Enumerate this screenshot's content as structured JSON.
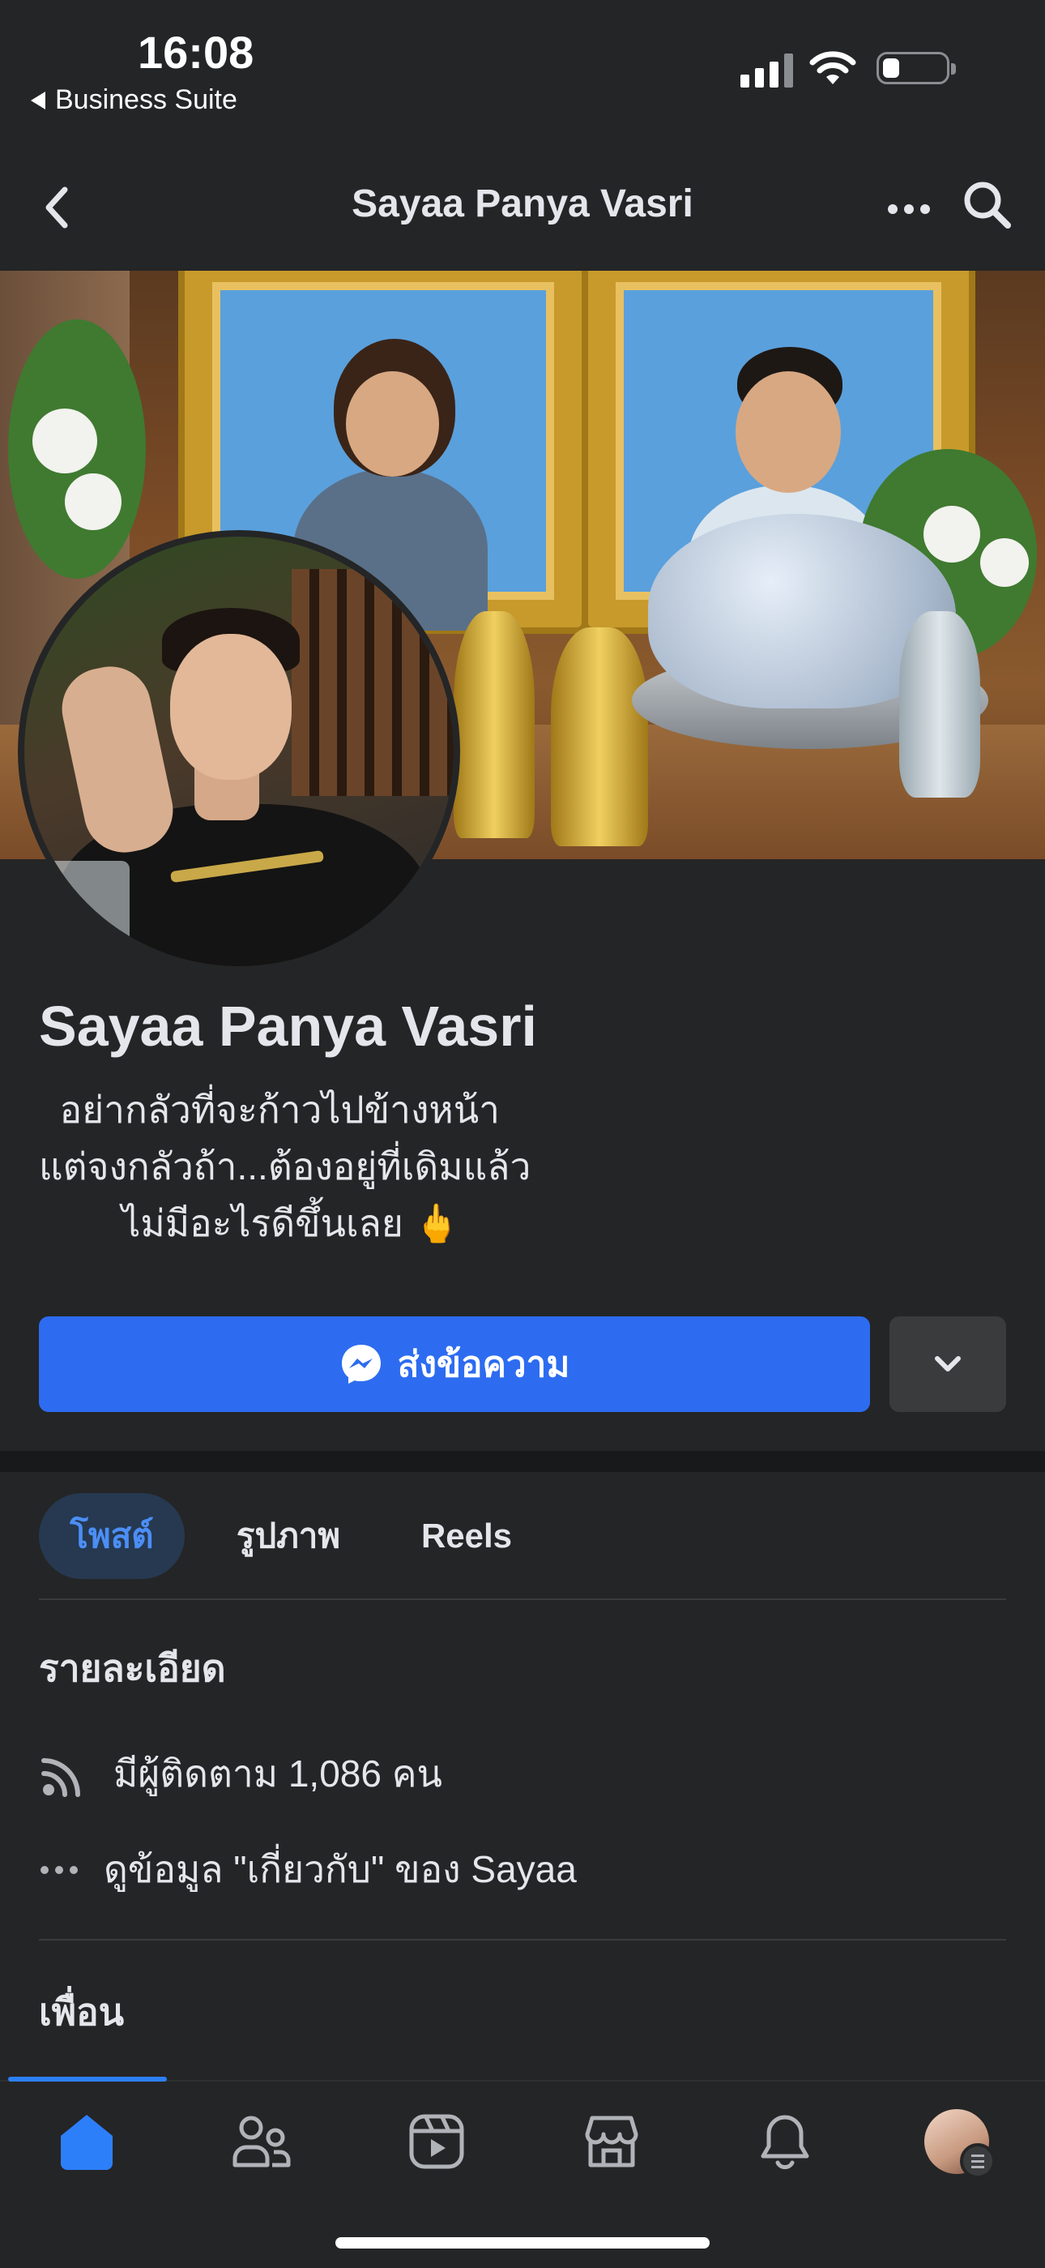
{
  "status_bar": {
    "time": "16:08",
    "back_app": "Business Suite"
  },
  "header": {
    "title": "Sayaa Panya Vasri"
  },
  "profile": {
    "name": "Sayaa Panya Vasri",
    "bio": "  อย่ากลัวที่จะก้าวไปข้างหน้า\nแต่จงกลัวถ้า...ต้องอยู่ที่เดิมแล้ว\n        ไม่มีอะไรดีขึ้นเลย 🖕"
  },
  "actions": {
    "message_label": "ส่งข้อความ"
  },
  "tabs": [
    {
      "label": "โพสต์",
      "active": true
    },
    {
      "label": "รูปภาพ",
      "active": false
    },
    {
      "label": "Reels",
      "active": false
    }
  ],
  "details": {
    "title": "รายละเอียด",
    "followers": "มีผู้ติดตาม 1,086 คน",
    "about": "ดูข้อมูล \"เกี่ยวกับ\" ของ Sayaa"
  },
  "friends": {
    "title": "เพื่อน"
  },
  "colors": {
    "background": "#242526",
    "accent": "#2d6cf0",
    "active_tab_bg": "#263951",
    "active_tab_text": "#4b8ef5"
  },
  "bottom_nav": [
    {
      "icon": "home-icon",
      "active": true
    },
    {
      "icon": "friends-icon",
      "active": false
    },
    {
      "icon": "video-icon",
      "active": false
    },
    {
      "icon": "marketplace-icon",
      "active": false
    },
    {
      "icon": "bell-icon",
      "active": false
    },
    {
      "icon": "profile-menu-avatar",
      "active": false
    }
  ]
}
